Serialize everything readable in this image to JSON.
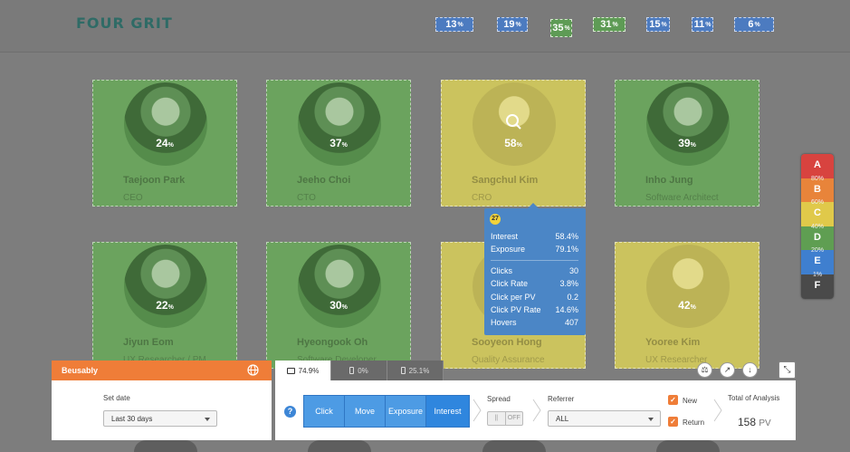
{
  "header": {
    "logo": "FOUR GRIT",
    "nav": [
      {
        "value": "13",
        "unit": "%",
        "bg": "#4c7bc0",
        "border": "#c9d6ee"
      },
      {
        "value": "19",
        "unit": "%",
        "bg": "#4c7bc0",
        "border": "#c9d6ee"
      },
      {
        "value": "35",
        "unit": "%",
        "bg": "#5e9b55",
        "border": "#d9e9d2"
      },
      {
        "value": "31",
        "unit": "%",
        "bg": "#5e9b55",
        "border": "#d9e9d2"
      },
      {
        "value": "15",
        "unit": "%",
        "bg": "#4c7bc0",
        "border": "#c9d6ee"
      },
      {
        "value": "11",
        "unit": "%",
        "bg": "#4c7bc0",
        "border": "#c9d6ee"
      },
      {
        "value": "6",
        "unit": "%",
        "bg": "#4c7bc0",
        "border": "#c9d6ee"
      }
    ]
  },
  "team": [
    {
      "name": "Taejoon Park",
      "role": "CEO",
      "value": "24",
      "unit": "%"
    },
    {
      "name": "Jeeho Choi",
      "role": "CTO",
      "value": "37",
      "unit": "%"
    },
    {
      "name": "Sangchul Kim",
      "role": "CRO",
      "value": "58",
      "unit": "%"
    },
    {
      "name": "Inho Jung",
      "role": "Software Architect",
      "value": "39",
      "unit": "%"
    },
    {
      "name": "Jiyun Eom",
      "role": "UX Researcher / PM",
      "value": "22",
      "unit": "%"
    },
    {
      "name": "Hyeongook Oh",
      "role": "Software Developer",
      "value": "30",
      "unit": "%"
    },
    {
      "name": "Sooyeon Hong",
      "role": "Quality Assurance",
      "value": "",
      "unit": ""
    },
    {
      "name": "Yooree Kim",
      "role": "UX Researcher",
      "value": "42",
      "unit": "%"
    }
  ],
  "tooltip": {
    "rank": "27",
    "rows_top": [
      {
        "label": "Interest",
        "value": "58.4%"
      },
      {
        "label": "Exposure",
        "value": "79.1%"
      }
    ],
    "rows_bottom": [
      {
        "label": "Clicks",
        "value": "30"
      },
      {
        "label": "Click Rate",
        "value": "3.8%"
      },
      {
        "label": "Click per PV",
        "value": "0.2"
      },
      {
        "label": "Click PV Rate",
        "value": "14.6%"
      },
      {
        "label": "Hovers",
        "value": "407"
      }
    ]
  },
  "legend": [
    {
      "letter": "A",
      "pct": "80%",
      "color": "#d8433f"
    },
    {
      "letter": "B",
      "pct": "60%",
      "color": "#e8843a"
    },
    {
      "letter": "C",
      "pct": "40%",
      "color": "#e0c94a"
    },
    {
      "letter": "D",
      "pct": "20%",
      "color": "#5f9e52"
    },
    {
      "letter": "E",
      "pct": "1%",
      "color": "#3f7fcf"
    },
    {
      "letter": "F",
      "pct": "",
      "color": "#4a4a4a"
    }
  ],
  "panel": {
    "brand": "Beusably",
    "set_date_label": "Set date",
    "date_value": "Last 30 days",
    "device_tabs": [
      {
        "label": "74.9%",
        "icon": "desktop-icon"
      },
      {
        "label": "0%",
        "icon": "tablet-icon"
      },
      {
        "label": "25.1%",
        "icon": "mobile-icon"
      }
    ],
    "modes": [
      "Click",
      "Move",
      "Exposure",
      "Interest"
    ],
    "spread_label": "Spread",
    "spread_on": "||",
    "spread_off": "OFF",
    "referrer_label": "Referrer",
    "referrer_value": "ALL",
    "new_label": "New",
    "return_label": "Return",
    "total_label": "Total of Analysis",
    "total_value": "158",
    "total_unit": "PV",
    "accent": "#ef7d38"
  }
}
